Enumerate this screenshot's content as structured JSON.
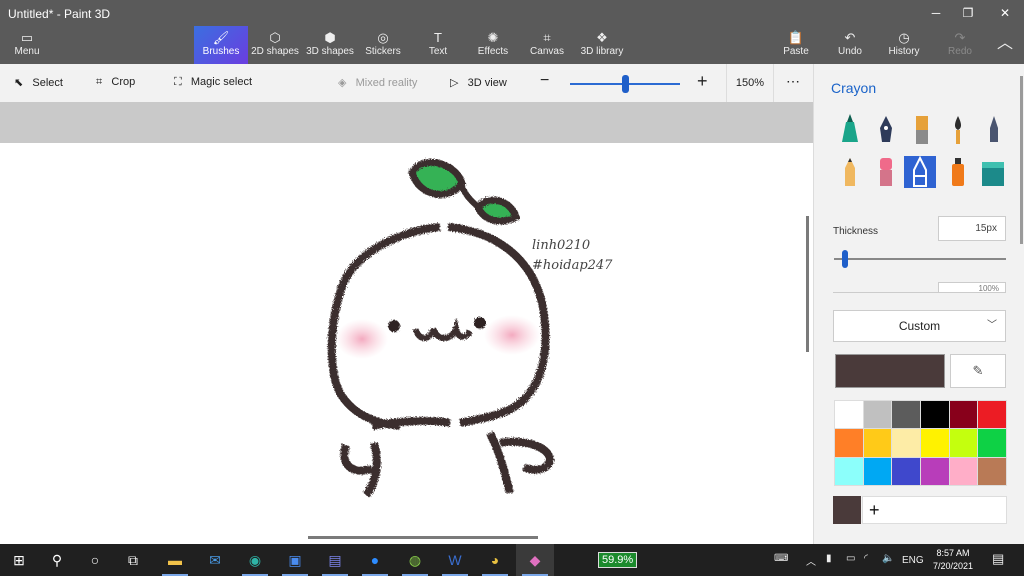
{
  "window": {
    "title": "Untitled* - Paint 3D"
  },
  "ribbon": {
    "menu": "Menu",
    "tools": [
      {
        "label": "Brushes",
        "icon": "brush-icon",
        "glyph": "🖌",
        "active": true
      },
      {
        "label": "2D shapes",
        "icon": "2d-shapes-icon",
        "glyph": "⬡"
      },
      {
        "label": "3D shapes",
        "icon": "3d-shapes-icon",
        "glyph": "⬢"
      },
      {
        "label": "Stickers",
        "icon": "stickers-icon",
        "glyph": "◎"
      },
      {
        "label": "Text",
        "icon": "text-icon",
        "glyph": "T"
      },
      {
        "label": "Effects",
        "icon": "effects-icon",
        "glyph": "✺"
      },
      {
        "label": "Canvas",
        "icon": "canvas-icon",
        "glyph": "⌗"
      },
      {
        "label": "3D library",
        "icon": "3d-library-icon",
        "glyph": "❖"
      }
    ],
    "paste": "Paste",
    "undo": "Undo",
    "history": "History",
    "redo": "Redo"
  },
  "toolbar": {
    "select": "Select",
    "crop": "Crop",
    "magic_select": "Magic select",
    "mixed_reality": "Mixed reality",
    "view_3d": "3D view",
    "zoom": "150%",
    "zoom_level": 0.5
  },
  "drawing": {
    "signature_line1": "linh0210",
    "signature_line2": "#hoidap247"
  },
  "panel": {
    "title": "Crayon",
    "thickness_label": "Thickness",
    "thickness_value": "15px",
    "opacity_value": "100%",
    "color_mode": "Custom",
    "current_color": "#4a3a3a",
    "swatches": [
      "#ffffff",
      "#c0c0c0",
      "#5c5c5c",
      "#000000",
      "#88001b",
      "#ec1c24",
      "#ff7f27",
      "#ffca18",
      "#fdeca6",
      "#fff200",
      "#c4ff0e",
      "#0ed145",
      "#8cfffb",
      "#00a8f3",
      "#3f48cc",
      "#b83dba",
      "#ffaec8",
      "#b97a56"
    ],
    "add_color": "+"
  },
  "taskbar": {
    "battery": "59.9%",
    "language": "ENG",
    "time": "8:57 AM",
    "date": "7/20/2021"
  }
}
